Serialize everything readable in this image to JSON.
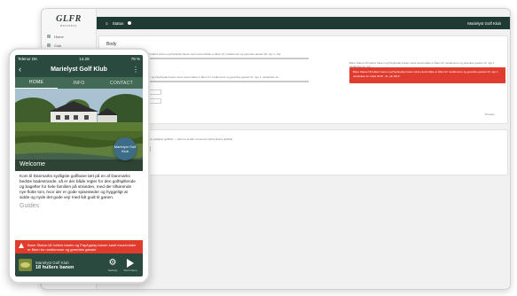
{
  "desktop": {
    "logo": "GLFR",
    "logo_sub": "BUSINESS",
    "nav": [
      "Home",
      "Club"
    ],
    "topbar_title": "Status",
    "topbar_right": "Marielyst Golf Klub",
    "body_heading": "Body",
    "field_label": "Header",
    "field_text": "Bane Status:18 hullers banen og PayAplay banen samt escerrolabe er åben for medlemmer og greenfee gæster 30. Jgs 1. Jas",
    "field_text2": "18 hullers banen og PayApplay banen samt escerrolabe er åben for medlemmer og greenfee gæster Nr. Jgs 1. udvidelsen kn",
    "preview_text": "Bane Status:18 hullers banen og PayApplay banen samt escerrolabe er åben for medlemmer og greenfee gæster Nr. Jgs 1. udvidelsen kn och",
    "redbox_text": "Bane Status:18 hullers banen og PayApplay banen samt escerrolabe er åben for medlemmer og greenfee gæster Nr. Jgs 1. udvidelsen kn rabat 2018 - 31. juli 2019",
    "date_placeholder": "dd-mm-åååå",
    "card2_text": "Kom til Danmarks sydligste golfklub – i ikke for at alle vi kommer herfra ekstra golfklub",
    "upload_label": "Vælg fil / Upload",
    "preview_footer": "Preview"
  },
  "phone": {
    "status_left": "Telenor DK",
    "status_time": "14.28",
    "status_right": "78 %",
    "app_title": "Marielyst Golf Klub",
    "tabs": [
      "HOME",
      "INFO",
      "CONTACT"
    ],
    "welcome": "Welcome",
    "fab_label": "Marielyst Golf Klub",
    "body_text": "Kom til Danmarks sydligste golfbane tæt på en af Danmarks bedste badestrande, så er der både regler for den golfspillende og bagefter for hele familien på stranden, med der tilhørende nye flotte torv, hvor der er gode spisesteder og hyggeligt at sidde og nyde det gode vejr med lidt godt til ganen.",
    "guides_heading": "Guides",
    "alert_text": "Bane Status:18 hullers banen og PayApplay banen samt escerrolabe er åben for medlemmer og greenfee gæster",
    "bottom_club": "Marielyst Golf Klub",
    "bottom_course": "18 hullers banen",
    "bottom_btn1": "Settings",
    "bottom_btn2": "Start Game"
  },
  "colors": {
    "brand_green": "#2b4a3f",
    "tab_green": "#436a55",
    "alert_red": "#e23a2c"
  }
}
